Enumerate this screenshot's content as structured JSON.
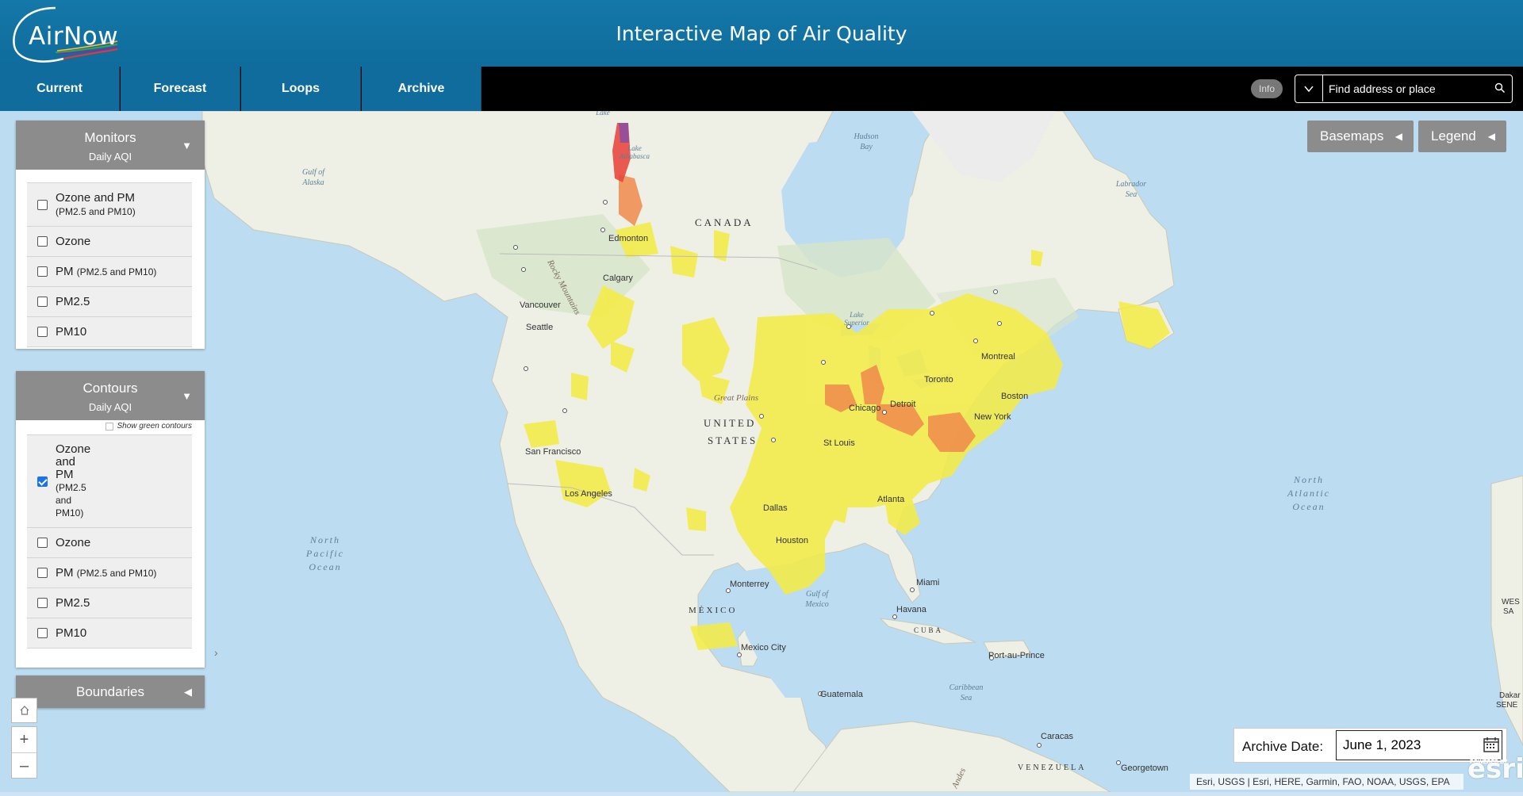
{
  "header": {
    "logo_text": "AirNow",
    "title": "Interactive Map of Air Quality"
  },
  "nav": {
    "tabs": [
      {
        "label": "Current"
      },
      {
        "label": "Forecast"
      },
      {
        "label": "Loops"
      },
      {
        "label": "Archive",
        "active": true
      }
    ],
    "info_label": "Info",
    "search_placeholder": "Find address or place"
  },
  "monitors_panel": {
    "title": "Monitors",
    "subtitle": "Daily AQI",
    "options": [
      {
        "label": "Ozone and PM",
        "sub": "(PM2.5 and PM10)",
        "checked": false
      },
      {
        "label": "Ozone",
        "sub": "",
        "checked": false
      },
      {
        "label": "PM",
        "sub": "(PM2.5 and PM10)",
        "checked": false
      },
      {
        "label": "PM2.5",
        "sub": "",
        "checked": false
      },
      {
        "label": "PM10",
        "sub": "",
        "checked": false
      }
    ]
  },
  "contours_panel": {
    "title": "Contours",
    "subtitle": "Daily AQI",
    "show_green_label": "Show green contours",
    "options": [
      {
        "label_lines": [
          "Ozone",
          "and",
          "PM"
        ],
        "sub_lines": [
          "(PM2.5",
          "and",
          "PM10)"
        ],
        "checked": true
      },
      {
        "label": "Ozone",
        "sub": "",
        "checked": false
      },
      {
        "label": "PM",
        "sub": "(PM2.5 and PM10)",
        "checked": false
      },
      {
        "label": "PM2.5",
        "sub": "",
        "checked": false
      },
      {
        "label": "PM10",
        "sub": "",
        "checked": false
      }
    ]
  },
  "boundaries_panel": {
    "title": "Boundaries"
  },
  "map_buttons": {
    "basemaps": "Basemaps",
    "legend": "Legend"
  },
  "archive": {
    "label": "Archive Date:",
    "value": "June 1, 2023"
  },
  "attribution": "Esri, USGS | Esri, HERE, Garmin, FAO, NOAA, USGS, EPA",
  "esri": {
    "logo": "esri",
    "powered": "POWERED BY"
  },
  "colors": {
    "header": "#1478a8",
    "aqi_moderate": "#f5ec42",
    "aqi_usg": "#f08a4b",
    "aqi_unhealthy": "#e8483e",
    "aqi_very_unhealthy": "#8e4fa0",
    "ocean": "#bcdcf1",
    "land": "#eef0e6"
  },
  "map_labels": {
    "countries": [
      "CANADA",
      "UNITED",
      "STATES",
      "MÉXICO",
      "CUBA",
      "VENEZUELA"
    ],
    "cities": [
      "Edmonton",
      "Calgary",
      "Vancouver",
      "Seattle",
      "San Francisco",
      "Los Angeles",
      "Dallas",
      "Houston",
      "St Louis",
      "Chicago",
      "Detroit",
      "Toronto",
      "Montreal",
      "Boston",
      "New York",
      "Atlanta",
      "Miami",
      "Havana",
      "Monterrey",
      "Mexico City",
      "Guatemala",
      "Port-au-Prince",
      "Caracas",
      "Georgetown"
    ],
    "waters": [
      "Gulf of Alaska",
      "Hudson Bay",
      "Labrador Sea",
      "North Pacific Ocean",
      "North Atlantic Ocean",
      "Gulf of Mexico",
      "Caribbean Sea",
      "Lake Athabasca",
      "Lake Superior"
    ],
    "regions": [
      "Rocky Mountains",
      "Great Plains"
    ],
    "edge_partial": [
      "Lake",
      "WES",
      "SA",
      "Dakar",
      "SENE",
      "Andes"
    ]
  }
}
